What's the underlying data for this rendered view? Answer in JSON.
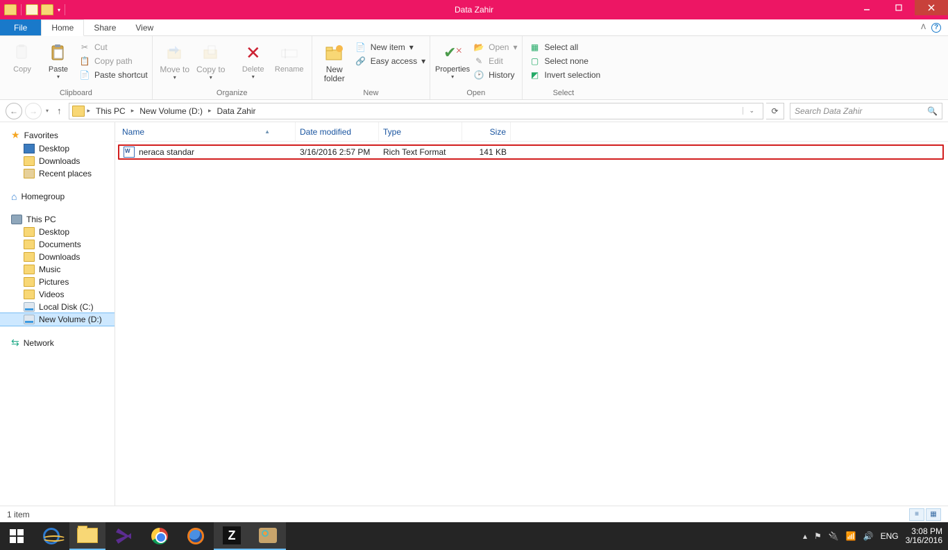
{
  "window": {
    "title": "Data Zahir"
  },
  "ribbon": {
    "tabs": {
      "file": "File",
      "home": "Home",
      "share": "Share",
      "view": "View"
    },
    "clipboard": {
      "label": "Clipboard",
      "copy": "Copy",
      "paste": "Paste",
      "cut": "Cut",
      "copypath": "Copy path",
      "pasteshortcut": "Paste shortcut"
    },
    "organize": {
      "label": "Organize",
      "moveto": "Move to",
      "copyto": "Copy to",
      "delete": "Delete",
      "rename": "Rename"
    },
    "new": {
      "label": "New",
      "newfolder": "New folder",
      "newitem": "New item",
      "easyaccess": "Easy access"
    },
    "open": {
      "label": "Open",
      "properties": "Properties",
      "open": "Open",
      "edit": "Edit",
      "history": "History"
    },
    "select": {
      "label": "Select",
      "all": "Select all",
      "none": "Select none",
      "invert": "Invert selection"
    }
  },
  "breadcrumb": {
    "root": "This PC",
    "vol": "New Volume (D:)",
    "folder": "Data Zahir"
  },
  "search": {
    "placeholder": "Search Data Zahir"
  },
  "sidebar": {
    "favorites": {
      "label": "Favorites",
      "items": [
        "Desktop",
        "Downloads",
        "Recent places"
      ]
    },
    "homegroup": "Homegroup",
    "thispc": {
      "label": "This PC",
      "items": [
        "Desktop",
        "Documents",
        "Downloads",
        "Music",
        "Pictures",
        "Videos",
        "Local Disk (C:)",
        "New Volume (D:)"
      ]
    },
    "network": "Network"
  },
  "columns": {
    "name": "Name",
    "date": "Date modified",
    "type": "Type",
    "size": "Size"
  },
  "files": [
    {
      "name": "neraca standar",
      "date": "3/16/2016 2:57 PM",
      "type": "Rich Text Format",
      "size": "141 KB"
    }
  ],
  "status": {
    "count": "1 item"
  },
  "tray": {
    "lang": "ENG",
    "time": "3:08 PM",
    "date": "3/16/2016"
  }
}
